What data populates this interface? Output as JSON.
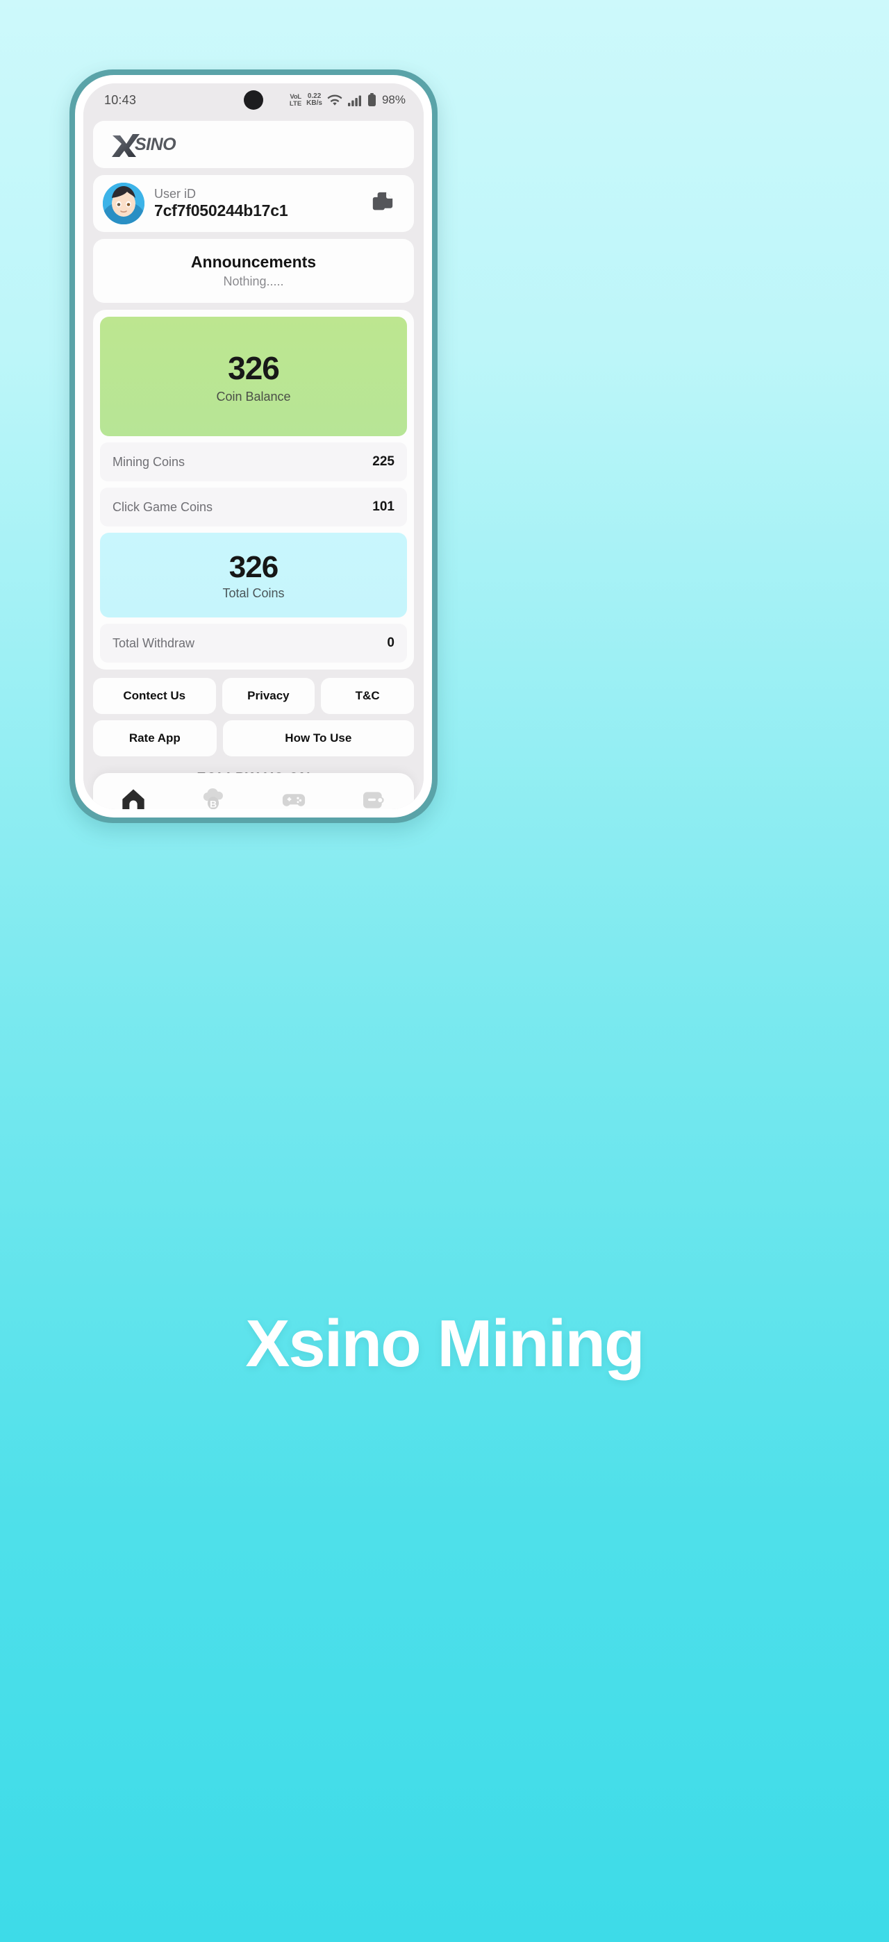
{
  "statusbar": {
    "time": "10:43",
    "volte_line1": "VoLTE",
    "volte_top": "VoL",
    "volte_bottom": "LTE",
    "net_speed_value": "0.22",
    "net_speed_unit": "KB/s",
    "battery_percent": "98%",
    "icons": [
      "volte-icon",
      "network-speed",
      "wifi-icon",
      "cellular-signal-icon",
      "battery-icon"
    ]
  },
  "header": {
    "logo_mark": "X",
    "logo_text": "SINO",
    "app_name": "Xsino"
  },
  "user": {
    "label": "User iD",
    "id": "7cf7f050244b17c1",
    "copy_icon": "copy-icon",
    "avatar_icon": "avatar"
  },
  "announcements": {
    "title": "Announcements",
    "body": "Nothing....."
  },
  "balance": {
    "coin_balance_value": "326",
    "coin_balance_label": "Coin Balance",
    "rows": [
      {
        "label": "Mining Coins",
        "value": "225"
      },
      {
        "label": "Click Game Coins",
        "value": "101"
      }
    ],
    "total_value": "326",
    "total_label": "Total Coins",
    "withdraw_label": "Total Withdraw",
    "withdraw_value": "0"
  },
  "links": {
    "contact": "Contect Us",
    "privacy": "Privacy",
    "tc": "T&C",
    "rate": "Rate App",
    "how": "How To Use"
  },
  "follow": {
    "title": "FOLLPW US ON"
  },
  "nav": [
    {
      "name": "home",
      "icon": "home-icon",
      "active": true
    },
    {
      "name": "mining",
      "icon": "cloud-bitcoin-icon",
      "active": false
    },
    {
      "name": "game",
      "icon": "gamepad-icon",
      "active": false
    },
    {
      "name": "wallet",
      "icon": "wallet-icon",
      "active": false
    }
  ],
  "footer": {
    "title": "Xsino Mining"
  },
  "colors": {
    "background_top": "#cdf9fb",
    "background_bottom": "#3ddbe8",
    "phone_frame": "#5aa3a8",
    "balance_green": "#bde690",
    "total_blue": "#c9f6fd",
    "accent_dark": "#2b2b2b"
  }
}
